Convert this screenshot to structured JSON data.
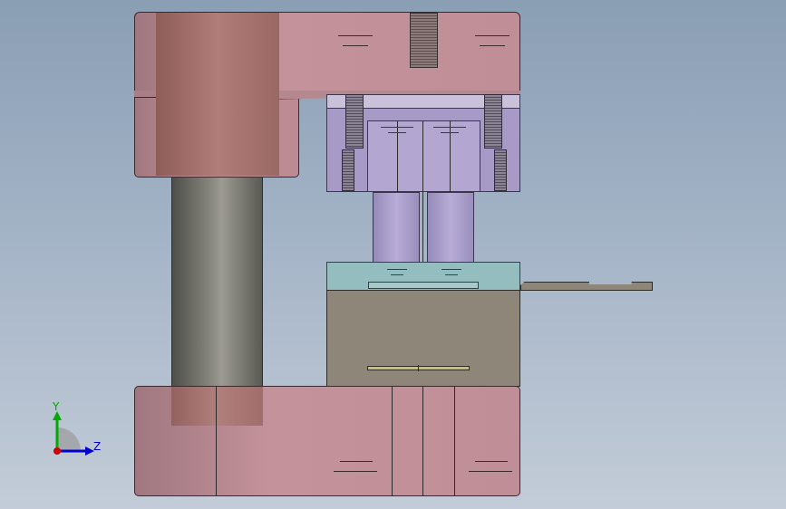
{
  "viewport": {
    "background_top": "#8a9eb4",
    "background_bottom": "#c3ccd8"
  },
  "triad": {
    "y_label": "Y",
    "z_label": "Z",
    "y_color": "#00aa00",
    "z_color": "#0000cc",
    "x_color": "#cc0000"
  },
  "model": {
    "upper_die_shoe_color": "#b8878f",
    "guide_bushing_color": "#a8746f",
    "guide_post_color": "#7a7a72",
    "punch_holder_color": "#a79ac6",
    "stripper_color": "#93bdbf",
    "die_block_color": "#8d8679",
    "lower_die_shoe_color": "#b8878f",
    "strip_color": "#8d8679"
  }
}
